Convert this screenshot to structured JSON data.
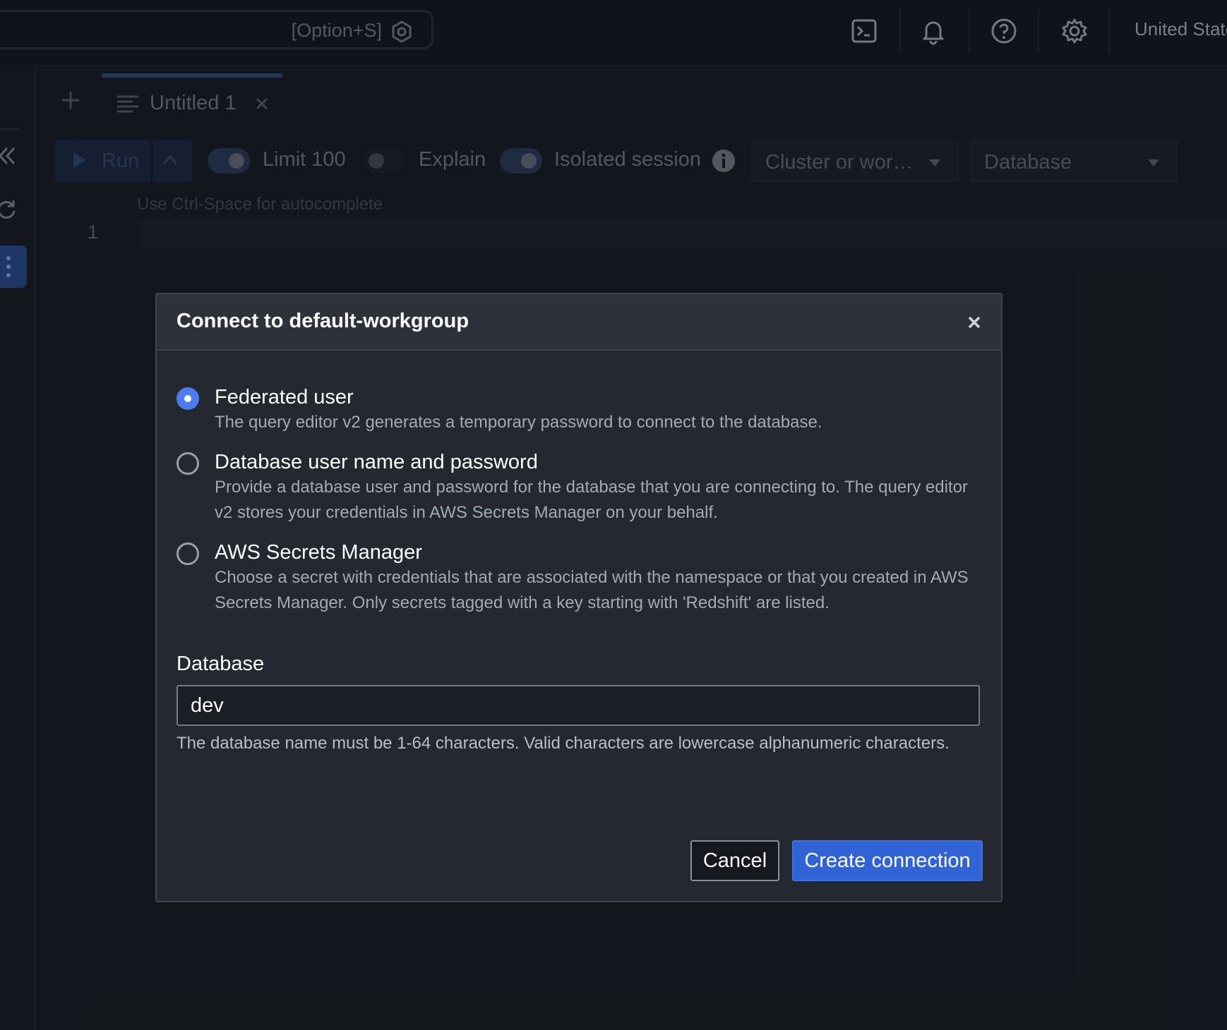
{
  "topbar": {
    "search_shortcut": "[Option+S]",
    "region": "United States"
  },
  "tabs": [
    {
      "label": "Untitled 1"
    }
  ],
  "toolbar": {
    "run_label": "Run",
    "limit_label": "Limit 100",
    "limit_on": true,
    "explain_label": "Explain",
    "explain_on": false,
    "isolated_label": "Isolated session",
    "isolated_on": true,
    "cluster_select": "Cluster or wor…",
    "database_select": "Database"
  },
  "editor": {
    "hint": "Use Ctrl-Space for autocomplete",
    "line_number": "1"
  },
  "modal": {
    "title": "Connect to default-workgroup",
    "options": [
      {
        "label": "Federated user",
        "description": "The query editor v2 generates a temporary password to connect to the database.",
        "checked": true
      },
      {
        "label": "Database user name and password",
        "description": "Provide a database user and password for the database that you are connecting to. The query editor v2 stores your credentials in AWS Secrets Manager on your behalf.",
        "checked": false
      },
      {
        "label": "AWS Secrets Manager",
        "description": "Choose a secret with credentials that are associated with the namespace or that you created in AWS Secrets Manager. Only secrets tagged with a key starting with 'Redshift' are listed.",
        "checked": false
      }
    ],
    "database_label": "Database",
    "database_value": "dev",
    "database_hint": "The database name must be 1-64 characters. Valid characters are lowercase alphanumeric characters.",
    "cancel_label": "Cancel",
    "create_label": "Create connection"
  },
  "colors": {
    "background": "#15181e",
    "modal": "#242831",
    "accent": "#2f63d6",
    "radio_checked": "#4b7df0"
  },
  "icons": [
    "search-shortcut-icon",
    "cloudshell-icon",
    "bell-icon",
    "help-icon",
    "gear-icon",
    "collapse-icon",
    "refresh-icon",
    "more-icon",
    "plus-icon",
    "document-icon",
    "close-icon",
    "play-icon",
    "chevron-up-icon",
    "info-icon",
    "caret-down-icon"
  ]
}
